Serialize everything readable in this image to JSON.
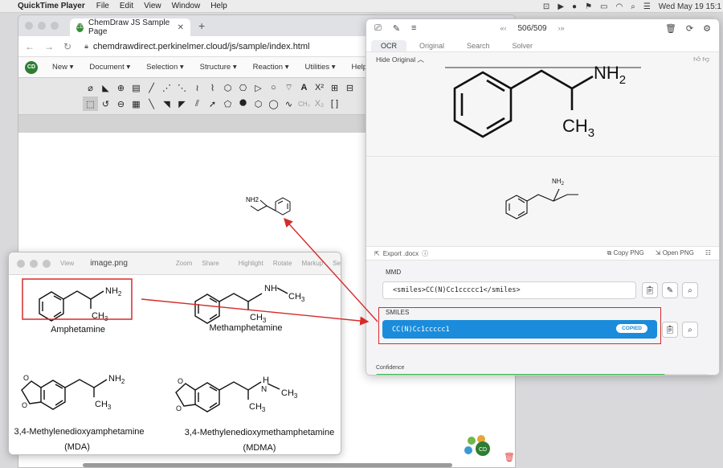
{
  "menubar": {
    "app": "QuickTime Player",
    "items": [
      "File",
      "Edit",
      "View",
      "Window",
      "Help"
    ],
    "clock": "Wed May 19  15:1"
  },
  "browser": {
    "tab_title": "ChemDraw JS Sample Page",
    "url": "chemdrawdirect.perkinelmer.cloud/js/sample/index.html",
    "logo": "CD",
    "menu": [
      "New ▾",
      "Document ▾",
      "Selection ▾",
      "Structure ▾",
      "Reaction ▾",
      "Utilities ▾",
      "Help ▾"
    ],
    "canvas_molecule_label": "NH2"
  },
  "preview": {
    "title": "image.png",
    "toolbar": [
      "View",
      "Zoom",
      "Share",
      "Highlight",
      "Rotate",
      "Markup",
      "Search"
    ],
    "labels": [
      "Amphetamine",
      "Methamphetamine",
      "3,4-Methylenedioxyamphetamine",
      "(MDA)",
      "3,4-Methylenedioxymethamphetamine",
      "(MDMA)"
    ]
  },
  "panel": {
    "page_counter": "506/509",
    "tabs": [
      "OCR",
      "Original",
      "Search",
      "Solver"
    ],
    "active_tab": "OCR",
    "hide_original": "Hide Original",
    "export_docx": "Export .docx",
    "copy_png": "Copy PNG",
    "open_png": "Open PNG",
    "mmd_label": "MMD",
    "mmd_value": "<smiles>CC(N)Cc1ccccc1</smiles>",
    "smiles_label": "SMILES",
    "smiles_value": "CC(N)Cc1ccccc1",
    "copied_badge": "COPIED",
    "confidence_label": "Confidence",
    "confidence": 0.87
  },
  "colors": {
    "accent": "#1a8cdb",
    "confidence": "#34c04a",
    "annotation": "#d62b2b"
  }
}
